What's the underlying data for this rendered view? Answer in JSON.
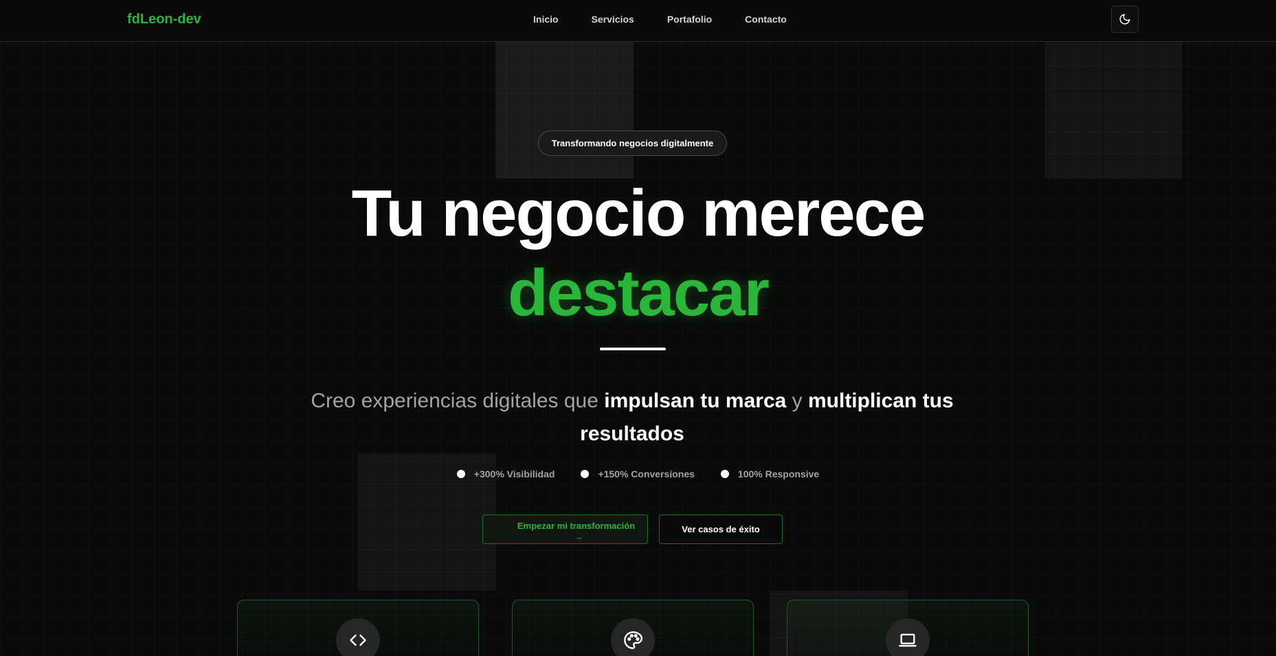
{
  "brand": {
    "name": "fdLeon-dev",
    "color": "#2bb53b"
  },
  "nav": {
    "links": [
      "Inicio",
      "Servicios",
      "Portafolio",
      "Contacto"
    ],
    "theme_toggle_icon": "moon-icon"
  },
  "hero": {
    "badge": "Transformando negocios digitalmente",
    "title_line1": "Tu negocio merece",
    "title_line2": "destacar",
    "subtitle": {
      "part1": "Creo experiencias digitales que ",
      "strong1": "impulsan tu marca",
      "part2": " y ",
      "strong2": "multiplican tus resultados"
    },
    "stats": [
      "+300% Visibilidad",
      "+150% Conversiones",
      "100% Responsive"
    ],
    "primary_button": {
      "label": "Empezar mi transformación",
      "arrow": "→"
    },
    "secondary_button": {
      "label": "Ver casos de éxito"
    }
  },
  "services": {
    "cards": [
      {
        "icon": "code-icon"
      },
      {
        "icon": "palette-icon"
      },
      {
        "icon": "laptop-icon"
      }
    ]
  },
  "colors": {
    "accent": "#2bb53b",
    "background": "#0a0a0a",
    "text_muted": "#a3a3a3"
  }
}
